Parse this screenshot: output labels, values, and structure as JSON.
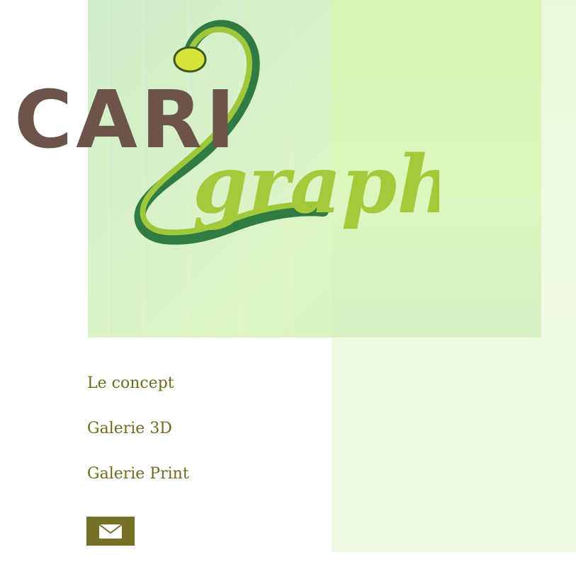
{
  "logo": {
    "word1": "CARI",
    "word2": "graph",
    "colors": {
      "brown": "#6d544b",
      "light_green": "#9fc73b",
      "dark_green": "#2f7b43",
      "yellow": "#d7e43c"
    }
  },
  "nav": {
    "items": [
      "Le concept",
      "Galerie 3D",
      "Galerie Print"
    ]
  },
  "contact": {
    "icon": "envelope-icon",
    "button_color": "#757024"
  }
}
